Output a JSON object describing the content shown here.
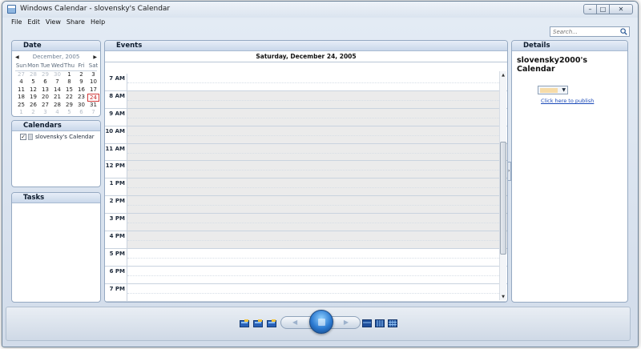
{
  "window": {
    "title": "Windows Calendar - slovensky's Calendar"
  },
  "menu": [
    "File",
    "Edit",
    "View",
    "Share",
    "Help"
  ],
  "search": {
    "placeholder": "Search..."
  },
  "date_panel": {
    "title": "Date",
    "month_label": "December, 2005",
    "weekdays": [
      "Sun",
      "Mon",
      "Tue",
      "Wed",
      "Thu",
      "Fri",
      "Sat"
    ],
    "weeks": [
      [
        "27",
        "28",
        "29",
        "30",
        "1",
        "2",
        "3"
      ],
      [
        "4",
        "5",
        "6",
        "7",
        "8",
        "9",
        "10"
      ],
      [
        "11",
        "12",
        "13",
        "14",
        "15",
        "16",
        "17"
      ],
      [
        "18",
        "19",
        "20",
        "21",
        "22",
        "23",
        "24"
      ],
      [
        "25",
        "26",
        "27",
        "28",
        "29",
        "30",
        "31"
      ],
      [
        "1",
        "2",
        "3",
        "4",
        "5",
        "6",
        "7"
      ]
    ],
    "selected_day": "24"
  },
  "calendars_panel": {
    "title": "Calendars",
    "items": [
      {
        "name": "slovensky's Calendar",
        "checked": true
      }
    ]
  },
  "tasks_panel": {
    "title": "Tasks"
  },
  "events_panel": {
    "title": "Events",
    "day_label": "Saturday, December 24, 2005",
    "hours": [
      "7 AM",
      "8 AM",
      "9 AM",
      "10 AM",
      "11 AM",
      "12 PM",
      "1 PM",
      "2 PM",
      "3 PM",
      "4 PM",
      "5 PM",
      "6 PM",
      "7 PM"
    ],
    "working_hours": [
      "8 AM",
      "9 AM",
      "10 AM",
      "11 AM",
      "12 PM",
      "1 PM",
      "2 PM",
      "3 PM",
      "4 PM"
    ]
  },
  "details_panel": {
    "title": "Details",
    "calendar_name": "slovensky2000's Calendar",
    "publish_link": "Click here to publish",
    "calendar_color": "#f6dba8"
  },
  "toolbar": {
    "icons": [
      "new-appointment-icon",
      "new-task-icon",
      "new-calendar-icon",
      "day-view-icon",
      "week-view-icon",
      "month-view-icon"
    ]
  },
  "colors": {
    "selected_day_border": "#d23a3a",
    "link": "#1a49b8",
    "work_hours_bg": "#ebebeb"
  }
}
